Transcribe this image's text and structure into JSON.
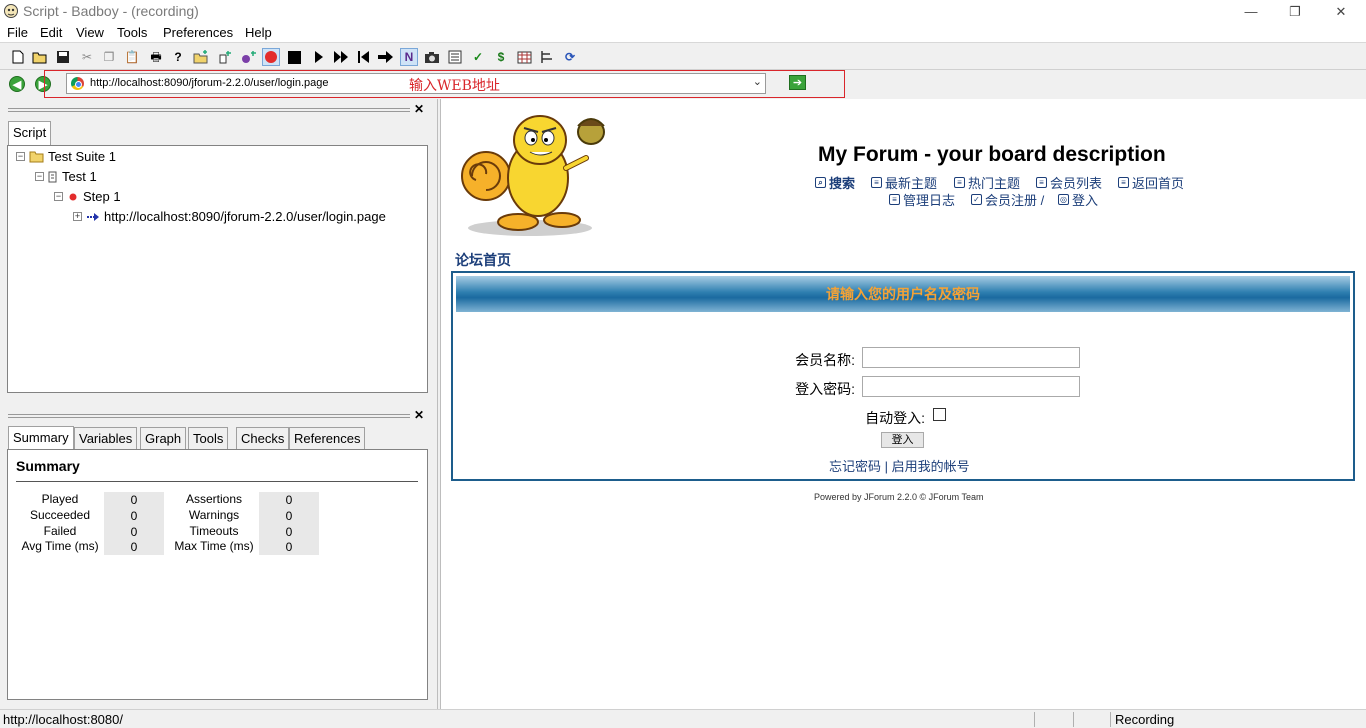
{
  "window": {
    "title": "Script - Badboy - (recording)",
    "minimize": "—",
    "restore": "❐",
    "close": "✕"
  },
  "menu": [
    "File",
    "Edit",
    "View",
    "Tools",
    "Preferences",
    "Help"
  ],
  "toolbar_icons": [
    "new-icon",
    "open-icon",
    "save-icon",
    "cut-icon",
    "copy-icon",
    "paste-icon",
    "print-icon",
    "help-icon",
    "add-folder-icon",
    "add-step-icon",
    "variable-icon",
    "record-icon",
    "stop-icon",
    "play-icon",
    "play-all-icon",
    "rewind-icon",
    "step-icon",
    "navigation-icon",
    "screenshot-icon",
    "report-icon",
    "check-icon",
    "dollar-icon",
    "table-icon",
    "tree-icon",
    "refresh-icon"
  ],
  "navigation": {
    "url": "http://localhost:8090/jforum-2.2.0/user/login.page",
    "annotation": "输入WEB地址"
  },
  "script_tab": "Script",
  "tree": {
    "suite": "Test Suite 1",
    "test": "Test 1",
    "step": "Step 1",
    "request": "http://localhost:8090/jforum-2.2.0/user/login.page"
  },
  "bottom_tabs": [
    "Summary",
    "Variables",
    "Graph",
    "Tools",
    "Checks",
    "References"
  ],
  "summary": {
    "title": "Summary",
    "left": [
      {
        "label": "Played",
        "value": "0"
      },
      {
        "label": "Succeeded",
        "value": "0"
      },
      {
        "label": "Failed",
        "value": "0"
      },
      {
        "label": "Avg Time (ms)",
        "value": "0"
      }
    ],
    "right": [
      {
        "label": "Assertions",
        "value": "0"
      },
      {
        "label": "Warnings",
        "value": "0"
      },
      {
        "label": "Timeouts",
        "value": "0"
      },
      {
        "label": "Max Time (ms)",
        "value": "0"
      }
    ]
  },
  "forum": {
    "title": "My Forum - your board description",
    "links_row1": [
      "搜索",
      "最新主题",
      "热门主题",
      "会员列表",
      "返回首页"
    ],
    "links_row2": [
      "管理日志",
      "会员注册 /",
      "登入"
    ],
    "breadcrumb": "论坛首页",
    "login_header": "请输入您的用户名及密码",
    "username_label": "会员名称:",
    "password_label": "登入密码:",
    "autologin_label": "自动登入:",
    "login_button": "登入",
    "footer_links": "忘记密码 | 启用我的帐号",
    "powered": "Powered by JForum 2.2.0 © JForum Team"
  },
  "status": {
    "url": "http://localhost:8080/",
    "mode": "Recording"
  },
  "colors": {
    "annotation": "#d9262b",
    "link": "#1d3f7a",
    "login_title": "#f4a236",
    "header_blue": "#1d5d8c"
  }
}
